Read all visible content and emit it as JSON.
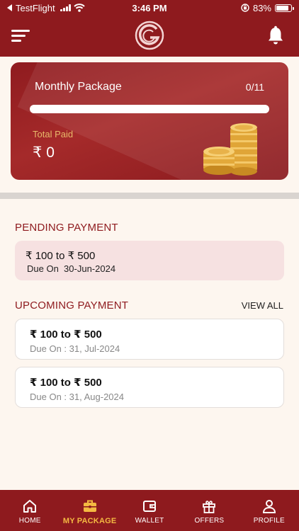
{
  "status_bar": {
    "back_app": "TestFlight",
    "time": "3:46 PM",
    "battery": "83%",
    "battery_level": 0.83
  },
  "header": {
    "menu_icon": "hamburger-icon",
    "logo_icon": "g-logo-icon",
    "notification_icon": "bell-icon"
  },
  "package": {
    "title": "Monthly Package",
    "count": "0/11",
    "progress_fraction": 0,
    "total_label": "Total Paid",
    "total_amount": "₹ 0"
  },
  "pending": {
    "section_title": "PENDING PAYMENT",
    "range": "₹ 100  to ₹ 500",
    "due_label": "Due On",
    "due_date": "30-Jun-2024"
  },
  "upcoming": {
    "section_title": "UPCOMING PAYMENT",
    "view_all": "VIEW ALL",
    "items": [
      {
        "range": "₹ 100  to  ₹ 500",
        "due": "Due On  : 31, Jul-2024"
      },
      {
        "range": "₹ 100  to  ₹ 500",
        "due": "Due On  : 31, Aug-2024"
      }
    ]
  },
  "nav": {
    "items": [
      {
        "label": "HOME",
        "icon": "home-icon"
      },
      {
        "label": "MY PACKAGE",
        "icon": "briefcase-icon",
        "active": true
      },
      {
        "label": "WALLET",
        "icon": "wallet-icon"
      },
      {
        "label": "OFFERS",
        "icon": "gift-icon"
      },
      {
        "label": "PROFILE",
        "icon": "person-icon"
      }
    ]
  },
  "colors": {
    "brand": "#8e1a1e",
    "accent": "#f4b942",
    "background": "#fdf6ef",
    "pending_bg": "#f6e1e1"
  }
}
